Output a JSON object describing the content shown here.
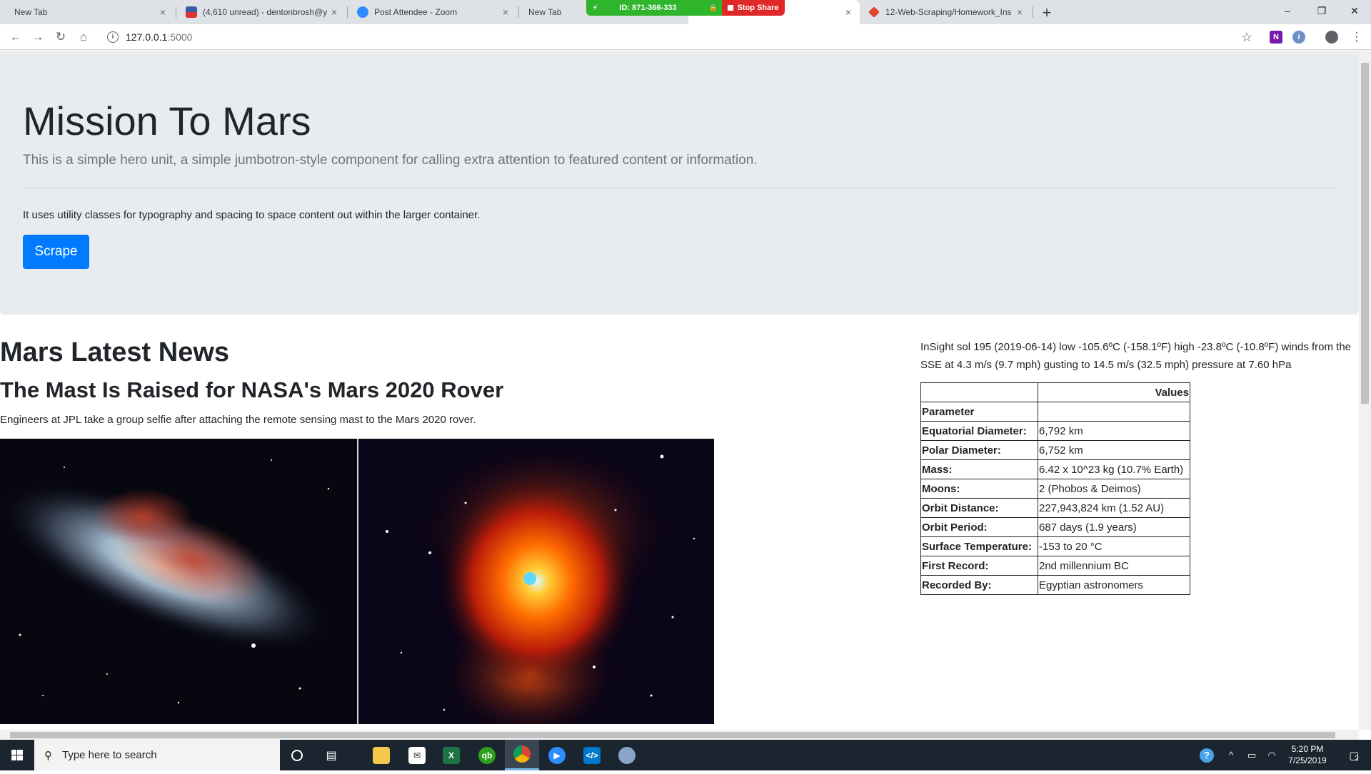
{
  "browser": {
    "tabs": [
      {
        "title": "New Tab",
        "close": "×"
      },
      {
        "title": "(4,610 unread) - dentonbrosh@y",
        "close": "×"
      },
      {
        "title": "Post Attendee - Zoom",
        "close": "×"
      },
      {
        "title": "New Tab",
        "close": ""
      },
      {
        "title": "",
        "close": "×"
      },
      {
        "title": "12-Web-Scraping/Homework_Ins",
        "close": "×"
      }
    ],
    "new_tab": "+",
    "window_controls": {
      "minimize": "–",
      "maximize": "❐",
      "close": "✕"
    },
    "zoom": {
      "meeting_id": "ID: 871-366-333",
      "stop_share": "Stop Share"
    },
    "nav": {
      "back": "←",
      "forward": "→",
      "reload": "↻",
      "home": "⌂"
    },
    "address": {
      "host": "127.0.0.1",
      "port": ":5000",
      "info": "i",
      "star": "☆"
    },
    "menu": "⋮"
  },
  "page": {
    "jumbotron": {
      "title": "Mission To Mars",
      "lead": "This is a simple hero unit, a simple jumbotron-style component for calling extra attention to featured content or information.",
      "text": "It uses utility classes for typography and spacing to space content out within the larger container.",
      "button": "Scrape"
    },
    "news": {
      "heading": "Mars Latest News",
      "title": "The Mast Is Raised for NASA's Mars 2020 Rover",
      "paragraph": "Engineers at JPL take a group selfie after attaching the remote sensing mast to the Mars 2020 rover."
    },
    "weather": "InSight sol 195 (2019-06-14) low -105.6ºC (-158.1ºF) high -23.8ºC (-10.8ºF) winds from the SSE at 4.3 m/s (9.7 mph) gusting to 14.5 m/s (32.5 mph) pressure at 7.60 hPa",
    "facts": {
      "header": [
        "",
        "Values"
      ],
      "index_label": "Parameter",
      "rows": [
        {
          "k": "Equatorial Diameter:",
          "v": "6,792 km"
        },
        {
          "k": "Polar Diameter:",
          "v": "6,752 km"
        },
        {
          "k": "Mass:",
          "v": "6.42 x 10^23 kg (10.7% Earth)"
        },
        {
          "k": "Moons:",
          "v": "2 (Phobos & Deimos)"
        },
        {
          "k": "Orbit Distance:",
          "v": "227,943,824 km (1.52 AU)"
        },
        {
          "k": "Orbit Period:",
          "v": "687 days (1.9 years)"
        },
        {
          "k": "Surface Temperature:",
          "v": "-153 to 20 °C"
        },
        {
          "k": "First Record:",
          "v": "2nd millennium BC"
        },
        {
          "k": "Recorded By:",
          "v": "Egyptian astronomers"
        }
      ]
    }
  },
  "taskbar": {
    "search_placeholder": "Type here to search",
    "apps": [
      "cortana",
      "task-view",
      "file-explorer",
      "mail",
      "excel",
      "quickbooks",
      "chrome",
      "zoom",
      "vscode",
      "paint"
    ],
    "clock": {
      "time": "5:20 PM",
      "date": "7/25/2019"
    },
    "notifications": "2"
  },
  "colors": {
    "jumbotron_bg": "#e9ecef",
    "primary": "#007bff",
    "zoom_green": "#2fb52b",
    "zoom_red": "#e02828",
    "taskbar_bg": "#1b2530"
  }
}
